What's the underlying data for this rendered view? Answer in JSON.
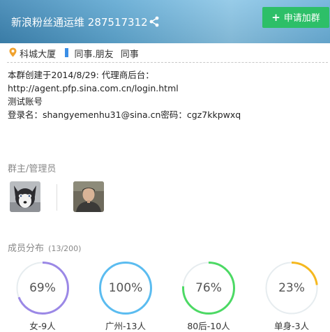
{
  "header": {
    "group_name": "新浪粉丝通运维",
    "group_id": "287517312",
    "join_button": "申请加群"
  },
  "tags": {
    "location": "科城大厦",
    "category": "同事.朋友",
    "type": "同事"
  },
  "description": [
    "本群创建于2014/8/29: 代理商后台：",
    "http://agent.pfp.sina.com.cn/login.html",
    "测试账号",
    "登录名：shangyemenhu31@sina.cn密码：cgz7kkpwxq"
  ],
  "admins": {
    "title": "群主/管理员"
  },
  "members": {
    "title": "成员分布",
    "count": "(13/200)",
    "stats": [
      {
        "percent": "69%",
        "value": 0.69,
        "label": "女-9人",
        "color": "#9b88e6"
      },
      {
        "percent": "100%",
        "value": 1.0,
        "label": "广州-13人",
        "color": "#5bbcf0"
      },
      {
        "percent": "76%",
        "value": 0.76,
        "label": "80后-10人",
        "color": "#4cd964"
      },
      {
        "percent": "23%",
        "value": 0.23,
        "label": "单身-3人",
        "color": "#f5b81f"
      }
    ]
  }
}
